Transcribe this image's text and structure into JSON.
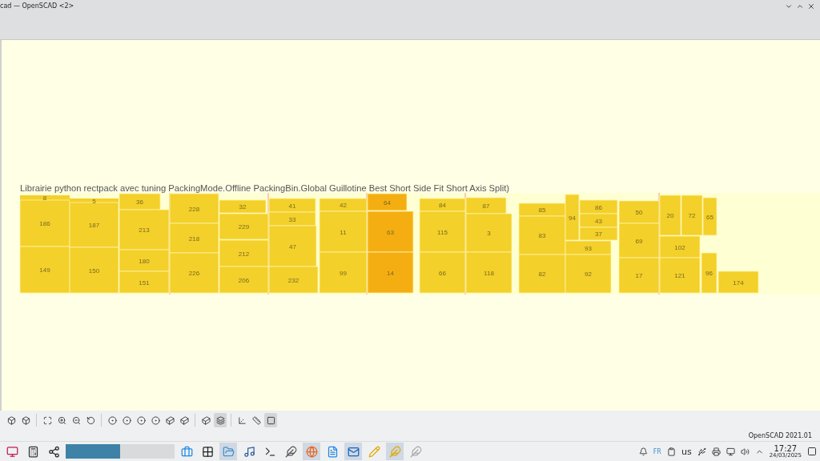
{
  "window": {
    "title": "cad — OpenSCAD <2>"
  },
  "viewport": {
    "caption": "Librairie python rectpack avec tuning PackingMode.Offline PackingBin.Global Guillotine Best Short Side Fit Short Axis Split)",
    "blocks": [
      {
        "label": "8",
        "color": "#f3d02a"
      },
      {
        "label": "186",
        "color": "#f3d02a"
      },
      {
        "label": "149",
        "color": "#f3d02a"
      },
      {
        "label": "5",
        "color": "#f3d02a"
      },
      {
        "label": "187",
        "color": "#f3d02a"
      },
      {
        "label": "150",
        "color": "#f3d02a"
      },
      {
        "label": "36",
        "color": "#f3d02a"
      },
      {
        "label": "213",
        "color": "#f3d02a"
      },
      {
        "label": "180",
        "color": "#f3d02a"
      },
      {
        "label": "151",
        "color": "#f3d02a"
      },
      {
        "label": "228",
        "color": "#f3d02a"
      },
      {
        "label": "218",
        "color": "#f3d02a"
      },
      {
        "label": "226",
        "color": "#f3d02a"
      },
      {
        "label": "32",
        "color": "#f3d02a"
      },
      {
        "label": "229",
        "color": "#f3d02a"
      },
      {
        "label": "212",
        "color": "#f3d02a"
      },
      {
        "label": "206",
        "color": "#f3d02a"
      },
      {
        "label": "41",
        "color": "#f3d02a"
      },
      {
        "label": "33",
        "color": "#f3d02a"
      },
      {
        "label": "47",
        "color": "#f3d02a"
      },
      {
        "label": "232",
        "color": "#f3d02a"
      },
      {
        "label": "42",
        "color": "#f3d02a"
      },
      {
        "label": "11",
        "color": "#f3d02a"
      },
      {
        "label": "99",
        "color": "#f3d02a"
      },
      {
        "label": "64",
        "color": "#f5ae12"
      },
      {
        "label": "63",
        "color": "#f5ae12"
      },
      {
        "label": "14",
        "color": "#f5ae12"
      },
      {
        "label": "84",
        "color": "#f3d02a"
      },
      {
        "label": "115",
        "color": "#f3d02a"
      },
      {
        "label": "66",
        "color": "#f3d02a"
      },
      {
        "label": "87",
        "color": "#f3d02a"
      },
      {
        "label": "3",
        "color": "#f3d02a"
      },
      {
        "label": "118",
        "color": "#f3d02a"
      },
      {
        "label": "85",
        "color": "#f3d02a"
      },
      {
        "label": "83",
        "color": "#f3d02a"
      },
      {
        "label": "82",
        "color": "#f3d02a"
      },
      {
        "label": "94",
        "color": "#f3d02a"
      },
      {
        "label": "86",
        "color": "#f3d02a"
      },
      {
        "label": "43",
        "color": "#f3d02a"
      },
      {
        "label": "37",
        "color": "#f3d02a"
      },
      {
        "label": "93",
        "color": "#f3d02a"
      },
      {
        "label": "92",
        "color": "#f3d02a"
      },
      {
        "label": "50",
        "color": "#f3d02a"
      },
      {
        "label": "69",
        "color": "#f3d02a"
      },
      {
        "label": "17",
        "color": "#f3d02a"
      },
      {
        "label": "20",
        "color": "#f3d02a"
      },
      {
        "label": "72",
        "color": "#f3d02a"
      },
      {
        "label": "65",
        "color": "#f3d02a"
      },
      {
        "label": "102",
        "color": "#f3d02a"
      },
      {
        "label": "121",
        "color": "#f3d02a"
      },
      {
        "label": "96",
        "color": "#f3d02a"
      },
      {
        "label": "174",
        "color": "#f3d02a"
      }
    ]
  },
  "view_toolbar": [
    {
      "selected": false
    },
    {
      "selected": false
    },
    {
      "selected": false
    },
    {
      "selected": false
    },
    {
      "selected": false
    },
    {
      "selected": false
    },
    {
      "selected": false
    },
    {
      "selected": false
    },
    {
      "selected": false
    },
    {
      "selected": false
    },
    {
      "selected": false
    },
    {
      "selected": false
    },
    {
      "selected": false
    },
    {
      "selected": true
    },
    {
      "selected": false
    },
    {
      "selected": false
    },
    {
      "selected": true
    }
  ],
  "status_bar": {
    "version": "OpenSCAD 2021.01"
  },
  "taskbar": {
    "apps": [
      {
        "selected": false
      },
      {
        "selected": false
      },
      {
        "selected": false
      },
      {
        "selected": false
      },
      {
        "selected": false
      },
      {
        "selected": true
      },
      {
        "selected": false
      },
      {
        "selected": false
      },
      {
        "selected": false
      },
      {
        "selected": true
      },
      {
        "selected": false
      },
      {
        "selected": true
      },
      {
        "selected": false
      },
      {
        "selected": true
      },
      {
        "selected": false
      }
    ],
    "keyboard": "FR",
    "layout": "us",
    "time": "17:27",
    "date": "24/03/2025"
  }
}
